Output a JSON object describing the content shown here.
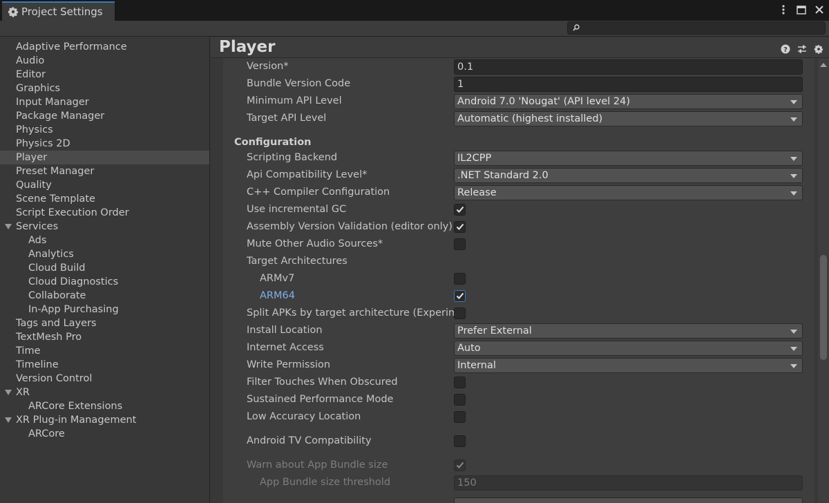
{
  "window": {
    "tab_title": "Project Settings"
  },
  "sidebar": {
    "items": [
      {
        "label": "Adaptive Performance"
      },
      {
        "label": "Audio"
      },
      {
        "label": "Editor"
      },
      {
        "label": "Graphics"
      },
      {
        "label": "Input Manager"
      },
      {
        "label": "Package Manager"
      },
      {
        "label": "Physics"
      },
      {
        "label": "Physics 2D"
      },
      {
        "label": "Player",
        "selected": true
      },
      {
        "label": "Preset Manager"
      },
      {
        "label": "Quality"
      },
      {
        "label": "Scene Template"
      },
      {
        "label": "Script Execution Order"
      },
      {
        "label": "Services",
        "expanded": true
      },
      {
        "label": "Ads",
        "child": true
      },
      {
        "label": "Analytics",
        "child": true
      },
      {
        "label": "Cloud Build",
        "child": true
      },
      {
        "label": "Cloud Diagnostics",
        "child": true
      },
      {
        "label": "Collaborate",
        "child": true
      },
      {
        "label": "In-App Purchasing",
        "child": true
      },
      {
        "label": "Tags and Layers"
      },
      {
        "label": "TextMesh Pro"
      },
      {
        "label": "Time"
      },
      {
        "label": "Timeline"
      },
      {
        "label": "Version Control"
      },
      {
        "label": "XR",
        "expanded": true
      },
      {
        "label": "ARCore Extensions",
        "child": true
      },
      {
        "label": "XR Plug-in Management",
        "expanded": true
      },
      {
        "label": "ARCore",
        "child": true
      }
    ]
  },
  "main": {
    "title": "Player",
    "fields": {
      "version": {
        "label": "Version*",
        "value": "0.1"
      },
      "bundle_version_code": {
        "label": "Bundle Version Code",
        "value": "1"
      },
      "min_api": {
        "label": "Minimum API Level",
        "value": "Android 7.0 'Nougat' (API level 24)"
      },
      "target_api": {
        "label": "Target API Level",
        "value": "Automatic (highest installed)"
      },
      "configuration_header": "Configuration",
      "scripting_backend": {
        "label": "Scripting Backend",
        "value": "IL2CPP"
      },
      "api_compat": {
        "label": "Api Compatibility Level*",
        "value": ".NET Standard 2.0"
      },
      "cpp_compiler": {
        "label": "C++ Compiler Configuration",
        "value": "Release"
      },
      "incremental_gc": {
        "label": "Use incremental GC",
        "checked": true
      },
      "assembly_validation": {
        "label": "Assembly Version Validation (editor only)",
        "checked": true
      },
      "mute_audio": {
        "label": "Mute Other Audio Sources*",
        "checked": false
      },
      "target_arch": {
        "label": "Target Architectures"
      },
      "armv7": {
        "label": "ARMv7",
        "checked": false
      },
      "arm64": {
        "label": "ARM64",
        "checked": true
      },
      "split_apks": {
        "label": "Split APKs by target architecture (Experim",
        "checked": false
      },
      "install_location": {
        "label": "Install Location",
        "value": "Prefer External"
      },
      "internet_access": {
        "label": "Internet Access",
        "value": "Auto"
      },
      "write_permission": {
        "label": "Write Permission",
        "value": "Internal"
      },
      "filter_touches": {
        "label": "Filter Touches When Obscured",
        "checked": false
      },
      "sustained_perf": {
        "label": "Sustained Performance Mode",
        "checked": false
      },
      "low_accuracy": {
        "label": "Low Accuracy Location",
        "checked": false
      },
      "android_tv": {
        "label": "Android TV Compatibility",
        "checked": false
      },
      "warn_bundle": {
        "label": "Warn about App Bundle size",
        "checked": true,
        "disabled": true
      },
      "bundle_threshold": {
        "label": "App Bundle size threshold",
        "value": "150",
        "disabled": true
      }
    }
  },
  "colors": {
    "accent": "#3a79bb",
    "link": "#7fb0ea",
    "panel": "#383838",
    "field": "#2a2a2a"
  }
}
